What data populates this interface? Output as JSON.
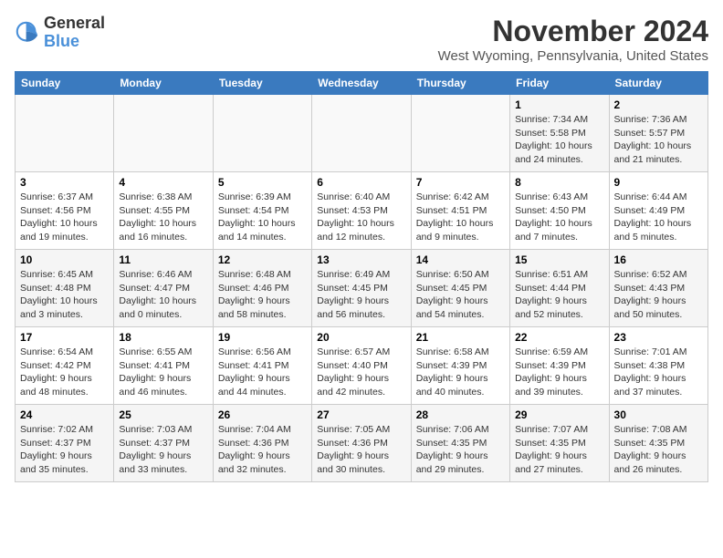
{
  "header": {
    "logo_general": "General",
    "logo_blue": "Blue",
    "month_title": "November 2024",
    "location": "West Wyoming, Pennsylvania, United States"
  },
  "days_of_week": [
    "Sunday",
    "Monday",
    "Tuesday",
    "Wednesday",
    "Thursday",
    "Friday",
    "Saturday"
  ],
  "weeks": [
    [
      {
        "day": "",
        "info": ""
      },
      {
        "day": "",
        "info": ""
      },
      {
        "day": "",
        "info": ""
      },
      {
        "day": "",
        "info": ""
      },
      {
        "day": "",
        "info": ""
      },
      {
        "day": "1",
        "info": "Sunrise: 7:34 AM\nSunset: 5:58 PM\nDaylight: 10 hours and 24 minutes."
      },
      {
        "day": "2",
        "info": "Sunrise: 7:36 AM\nSunset: 5:57 PM\nDaylight: 10 hours and 21 minutes."
      }
    ],
    [
      {
        "day": "3",
        "info": "Sunrise: 6:37 AM\nSunset: 4:56 PM\nDaylight: 10 hours and 19 minutes."
      },
      {
        "day": "4",
        "info": "Sunrise: 6:38 AM\nSunset: 4:55 PM\nDaylight: 10 hours and 16 minutes."
      },
      {
        "day": "5",
        "info": "Sunrise: 6:39 AM\nSunset: 4:54 PM\nDaylight: 10 hours and 14 minutes."
      },
      {
        "day": "6",
        "info": "Sunrise: 6:40 AM\nSunset: 4:53 PM\nDaylight: 10 hours and 12 minutes."
      },
      {
        "day": "7",
        "info": "Sunrise: 6:42 AM\nSunset: 4:51 PM\nDaylight: 10 hours and 9 minutes."
      },
      {
        "day": "8",
        "info": "Sunrise: 6:43 AM\nSunset: 4:50 PM\nDaylight: 10 hours and 7 minutes."
      },
      {
        "day": "9",
        "info": "Sunrise: 6:44 AM\nSunset: 4:49 PM\nDaylight: 10 hours and 5 minutes."
      }
    ],
    [
      {
        "day": "10",
        "info": "Sunrise: 6:45 AM\nSunset: 4:48 PM\nDaylight: 10 hours and 3 minutes."
      },
      {
        "day": "11",
        "info": "Sunrise: 6:46 AM\nSunset: 4:47 PM\nDaylight: 10 hours and 0 minutes."
      },
      {
        "day": "12",
        "info": "Sunrise: 6:48 AM\nSunset: 4:46 PM\nDaylight: 9 hours and 58 minutes."
      },
      {
        "day": "13",
        "info": "Sunrise: 6:49 AM\nSunset: 4:45 PM\nDaylight: 9 hours and 56 minutes."
      },
      {
        "day": "14",
        "info": "Sunrise: 6:50 AM\nSunset: 4:45 PM\nDaylight: 9 hours and 54 minutes."
      },
      {
        "day": "15",
        "info": "Sunrise: 6:51 AM\nSunset: 4:44 PM\nDaylight: 9 hours and 52 minutes."
      },
      {
        "day": "16",
        "info": "Sunrise: 6:52 AM\nSunset: 4:43 PM\nDaylight: 9 hours and 50 minutes."
      }
    ],
    [
      {
        "day": "17",
        "info": "Sunrise: 6:54 AM\nSunset: 4:42 PM\nDaylight: 9 hours and 48 minutes."
      },
      {
        "day": "18",
        "info": "Sunrise: 6:55 AM\nSunset: 4:41 PM\nDaylight: 9 hours and 46 minutes."
      },
      {
        "day": "19",
        "info": "Sunrise: 6:56 AM\nSunset: 4:41 PM\nDaylight: 9 hours and 44 minutes."
      },
      {
        "day": "20",
        "info": "Sunrise: 6:57 AM\nSunset: 4:40 PM\nDaylight: 9 hours and 42 minutes."
      },
      {
        "day": "21",
        "info": "Sunrise: 6:58 AM\nSunset: 4:39 PM\nDaylight: 9 hours and 40 minutes."
      },
      {
        "day": "22",
        "info": "Sunrise: 6:59 AM\nSunset: 4:39 PM\nDaylight: 9 hours and 39 minutes."
      },
      {
        "day": "23",
        "info": "Sunrise: 7:01 AM\nSunset: 4:38 PM\nDaylight: 9 hours and 37 minutes."
      }
    ],
    [
      {
        "day": "24",
        "info": "Sunrise: 7:02 AM\nSunset: 4:37 PM\nDaylight: 9 hours and 35 minutes."
      },
      {
        "day": "25",
        "info": "Sunrise: 7:03 AM\nSunset: 4:37 PM\nDaylight: 9 hours and 33 minutes."
      },
      {
        "day": "26",
        "info": "Sunrise: 7:04 AM\nSunset: 4:36 PM\nDaylight: 9 hours and 32 minutes."
      },
      {
        "day": "27",
        "info": "Sunrise: 7:05 AM\nSunset: 4:36 PM\nDaylight: 9 hours and 30 minutes."
      },
      {
        "day": "28",
        "info": "Sunrise: 7:06 AM\nSunset: 4:35 PM\nDaylight: 9 hours and 29 minutes."
      },
      {
        "day": "29",
        "info": "Sunrise: 7:07 AM\nSunset: 4:35 PM\nDaylight: 9 hours and 27 minutes."
      },
      {
        "day": "30",
        "info": "Sunrise: 7:08 AM\nSunset: 4:35 PM\nDaylight: 9 hours and 26 minutes."
      }
    ]
  ]
}
